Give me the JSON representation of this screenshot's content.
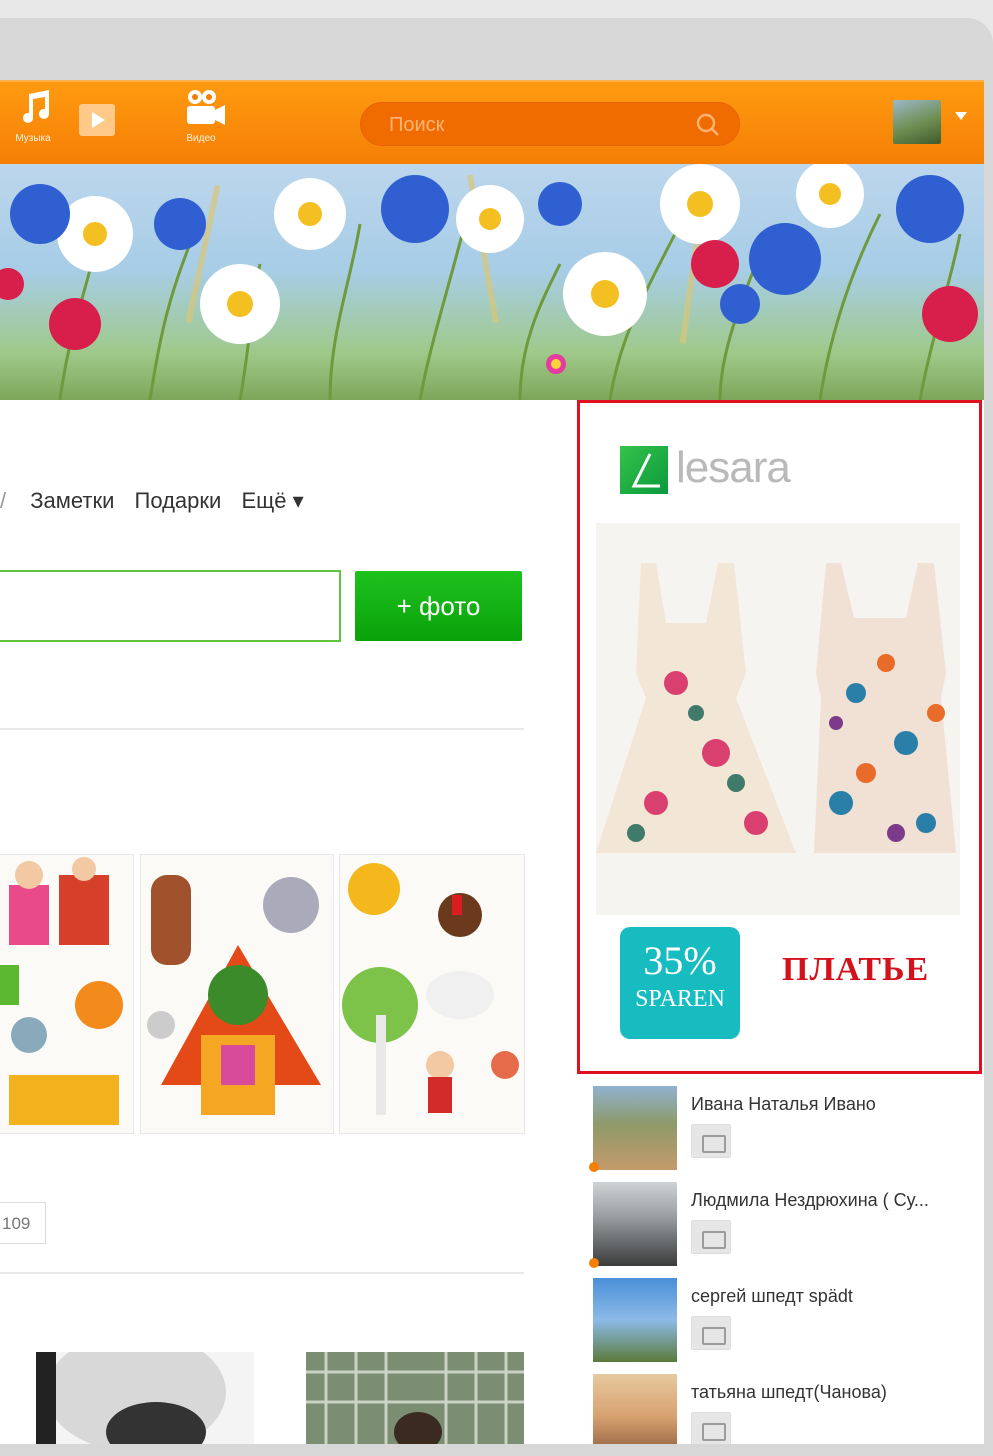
{
  "topbar": {
    "nav": [
      {
        "label": "Музыка",
        "icon": "music-note-icon"
      },
      {
        "label": "",
        "icon": "play-icon"
      },
      {
        "label": "Видео",
        "icon": "video-camera-icon"
      }
    ],
    "search_placeholder": "Поиск",
    "accent": "#f57f05"
  },
  "profile_menu": {
    "items": [
      "Заметки",
      "Подарки",
      "Ещё ▾"
    ]
  },
  "post_form": {
    "photo_button_label": "+ фото",
    "button_color": "#0aa20a"
  },
  "gallery": {
    "count": "109"
  },
  "ad": {
    "brand": "lesara",
    "badge_percent": "35%",
    "badge_text": "SPAREN",
    "title": "ПЛАТЬЕ",
    "border_color": "#e0111f"
  },
  "friends": [
    {
      "name": "Ивана Наталья Ивано",
      "online": true
    },
    {
      "name": "Людмила Нездрюхина ( Су...",
      "online": true
    },
    {
      "name": "сергей шпедт spädt",
      "online": false
    },
    {
      "name": "татьяна шпедт(Чанова)",
      "online": false
    }
  ]
}
